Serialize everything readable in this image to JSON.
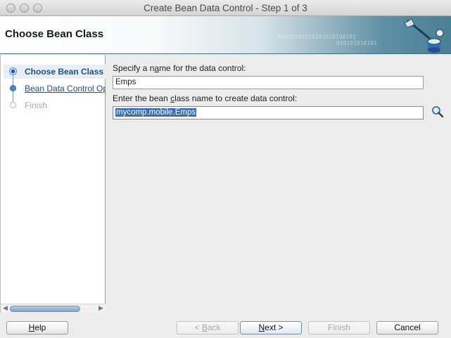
{
  "window": {
    "title": "Create Bean Data Control - Step 1 of 3"
  },
  "banner": {
    "title": "Choose Bean Class",
    "binary_top": "01010101010101010100101",
    "binary_bottom": "010101010101"
  },
  "steps": [
    {
      "label": "Choose Bean Class",
      "state": "current"
    },
    {
      "label": "Bean Data Control Op",
      "state": "link"
    },
    {
      "label": "Finish",
      "state": "disabled"
    }
  ],
  "form": {
    "name_label_pre": "Specify a n",
    "name_label_mnemonic": "a",
    "name_label_post": "me for the data control:",
    "name_value": "Emps",
    "class_label_pre": "Enter the bean ",
    "class_label_mnemonic": "c",
    "class_label_post": "lass name to create data control:",
    "class_value": "mycomp.mobile.Emps"
  },
  "buttons": {
    "help": "Help",
    "back": "< Back",
    "next": "Next >",
    "finish": "Finish",
    "cancel": "Cancel"
  },
  "colors": {
    "accent": "#1f4e8c",
    "selection": "#3a6db3"
  },
  "icons": {
    "browse": "magnifier-icon",
    "banner": "wizard-logo-icon"
  }
}
